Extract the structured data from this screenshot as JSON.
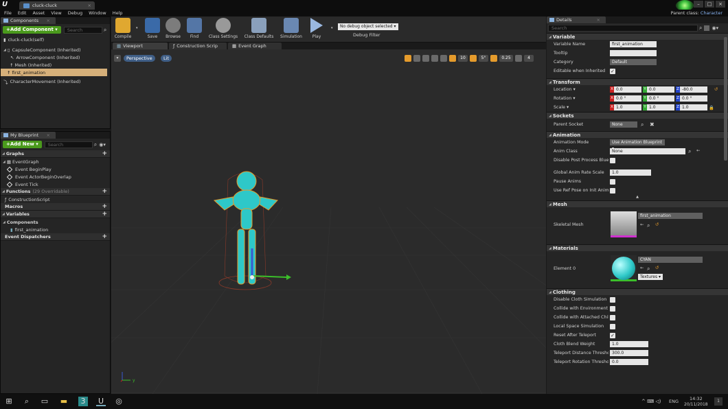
{
  "window": {
    "tab_title": "cluck-cluck",
    "parent_class_label": "Parent class:",
    "parent_class_value": "Character"
  },
  "menu": [
    "File",
    "Edit",
    "Asset",
    "View",
    "Debug",
    "Window",
    "Help"
  ],
  "components_panel": {
    "tab": "Components",
    "add_button": "+Add Component ▾",
    "search_placeholder": "Search",
    "self_item": "cluck-cluck(self)",
    "tree": [
      "CapsuleComponent (Inherited)",
      "ArrowComponent (Inherited)",
      "Mesh (Inherited)",
      "first_animation",
      "CharacterMovement (Inherited)"
    ]
  },
  "my_blueprint": {
    "tab": "My Blueprint",
    "add_new": "+Add New ▾",
    "search_placeholder": "Search",
    "graphs_label": "Graphs",
    "event_graph": "EventGraph",
    "events": [
      "Event BeginPlay",
      "Event ActorBeginOverlap",
      "Event Tick"
    ],
    "functions_label": "Functions",
    "functions_count": "(29 Overridable)",
    "construction_script": "ConstructionScript",
    "macros_label": "Macros",
    "variables_label": "Variables",
    "components_label": "Components",
    "component_var": "first_animation",
    "dispatchers_label": "Event Dispatchers"
  },
  "toolbar": {
    "compile": "Compile",
    "save": "Save",
    "browse": "Browse",
    "find": "Find",
    "class_settings": "Class Settings",
    "class_defaults": "Class Defaults",
    "simulation": "Simulation",
    "play": "Play",
    "debug_select": "No debug object selected ▾",
    "debug_filter": "Debug Filter"
  },
  "editor_tabs": [
    "Viewport",
    "Construction Scrip",
    "Event Graph"
  ],
  "viewport": {
    "perspective": "Perspective",
    "lit": "Lit",
    "grid_size": "10",
    "rot_snap": "5°",
    "scale_snap": "0.25",
    "cam_speed": "4",
    "axis_label": "y"
  },
  "details": {
    "tab": "Details",
    "search_placeholder": "Search",
    "variable": {
      "title": "Variable",
      "name_label": "Variable Name",
      "name_value": "first_animation",
      "tooltip_label": "Tooltip",
      "category_label": "Category",
      "category_value": "Default",
      "editable_label": "Editable when Inherited"
    },
    "transform": {
      "title": "Transform",
      "location_label": "Location ▾",
      "rotation_label": "Rotation ▾",
      "scale_label": "Scale ▾",
      "location": [
        "0.0",
        "0.0",
        "-80.0"
      ],
      "rotation": [
        "0.0 °",
        "0.0 °",
        "0.0 °"
      ],
      "scale": [
        "1.0",
        "1.0",
        "1.0"
      ]
    },
    "sockets": {
      "title": "Sockets",
      "parent_socket_label": "Parent Socket",
      "parent_socket_value": "None"
    },
    "animation": {
      "title": "Animation",
      "mode_label": "Animation Mode",
      "mode_value": "Use Animation Blueprint ▾",
      "anim_class_label": "Anim Class",
      "anim_class_value": "None",
      "disable_pp_label": "Disable Post Process Blueprint",
      "rate_label": "Global Anim Rate Scale",
      "rate_value": "1.0",
      "pause_label": "Pause Anims",
      "ref_pose_label": "Use Ref Pose on Init Anim"
    },
    "mesh": {
      "title": "Mesh",
      "skeletal_label": "Skeletal Mesh",
      "skeletal_value": "first_animation"
    },
    "materials": {
      "title": "Materials",
      "element_label": "Element 0",
      "element_value": "CYAN",
      "textures": "Textures ▾"
    },
    "clothing": {
      "title": "Clothing",
      "rows": [
        "Disable Cloth Simulation",
        "Collide with Environment",
        "Collide with Attached Children",
        "Local Space Simulation",
        "Reset After Teleport"
      ],
      "blend_label": "Cloth Blend Weight",
      "blend_value": "1.0",
      "tp_dist_label": "Teleport Distance Threshold",
      "tp_dist_value": "300.0",
      "tp_rot_label": "Teleport Rotation Threshold",
      "tp_rot_value": "0.0"
    }
  },
  "taskbar": {
    "language": "ENG",
    "time": "14:32",
    "date": "20/11/2018",
    "notifications": "1"
  },
  "colors": {
    "accent_green": "#4a9a1c",
    "selection": "#d6b07a",
    "mesh_cyan": "#2ec8c8",
    "outline_orange": "#e59b2c"
  }
}
